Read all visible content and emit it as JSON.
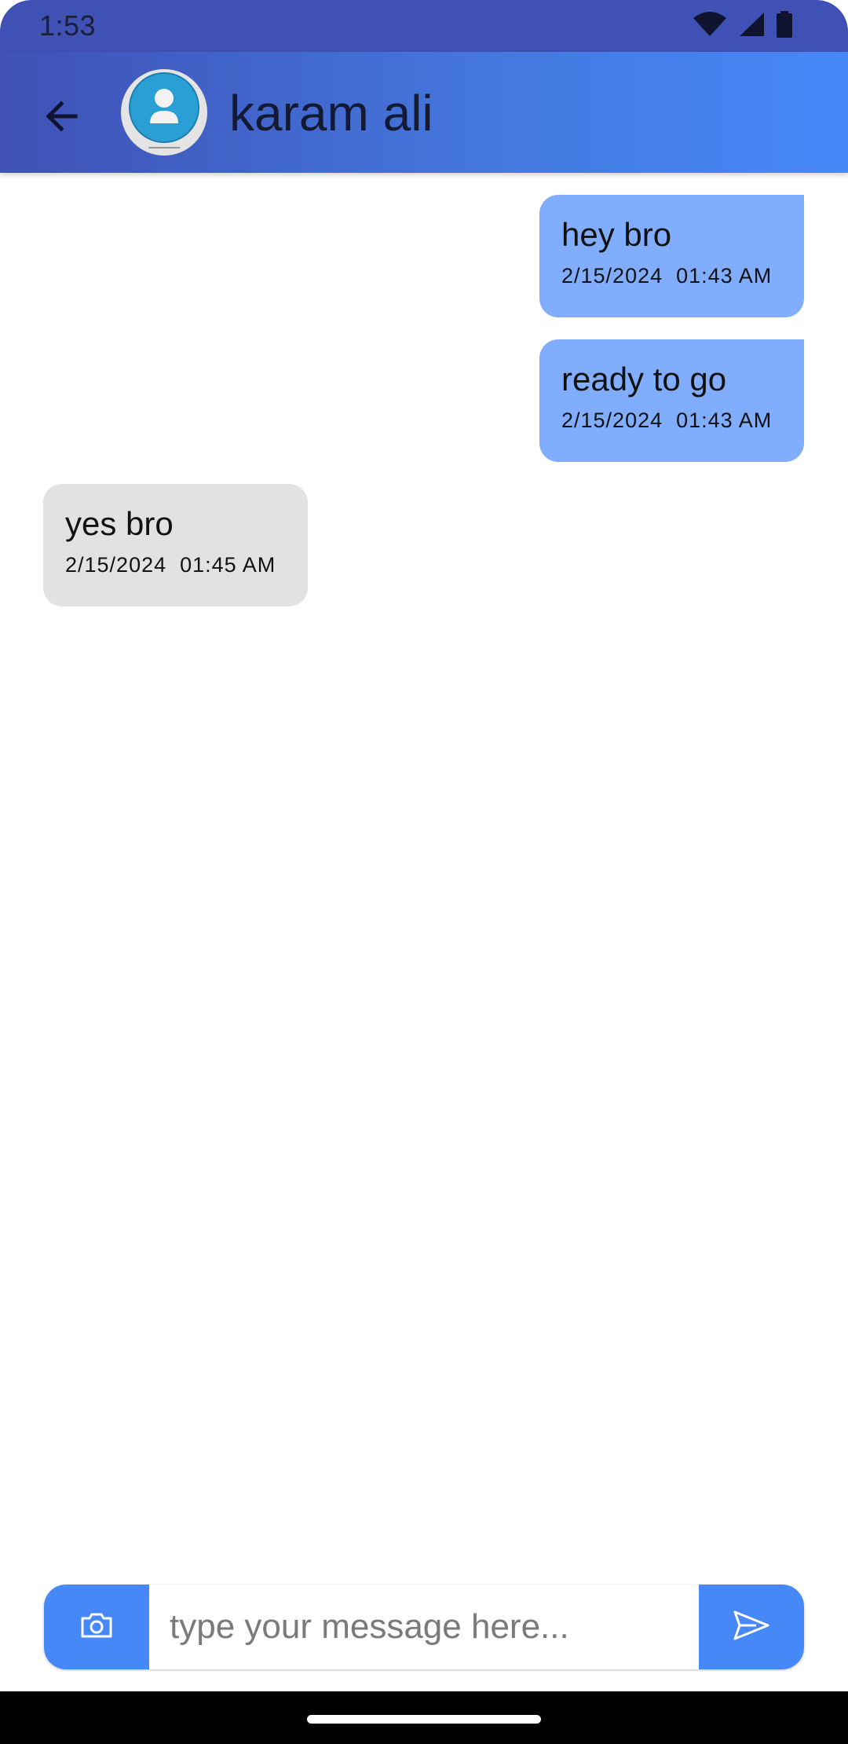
{
  "status_bar": {
    "time": "1:53",
    "icons": [
      "wifi-icon",
      "cellular-signal-icon",
      "battery-icon"
    ]
  },
  "app_bar": {
    "back_icon": "arrow-back-icon",
    "avatar_icon": "contact-avatar-icon",
    "contact_name": "karam ali"
  },
  "messages": [
    {
      "direction": "outgoing",
      "text": "hey bro",
      "timestamp": "2/15/2024  01:43 AM"
    },
    {
      "direction": "outgoing",
      "text": "ready to go",
      "timestamp": "2/15/2024  01:43 AM"
    },
    {
      "direction": "incoming",
      "text": "yes bro",
      "timestamp": "2/15/2024  01:45 AM"
    }
  ],
  "composer": {
    "camera_icon": "camera-icon",
    "input_value": "",
    "placeholder": "type your message here...",
    "send_icon": "send-icon"
  },
  "colors": {
    "status_bar": "#3f51b5",
    "app_bar_start": "#3f51b5",
    "app_bar_end": "#4688f8",
    "outgoing_bubble": "#80adfd",
    "incoming_bubble": "#e2e2e2",
    "accent": "#4688f8"
  }
}
